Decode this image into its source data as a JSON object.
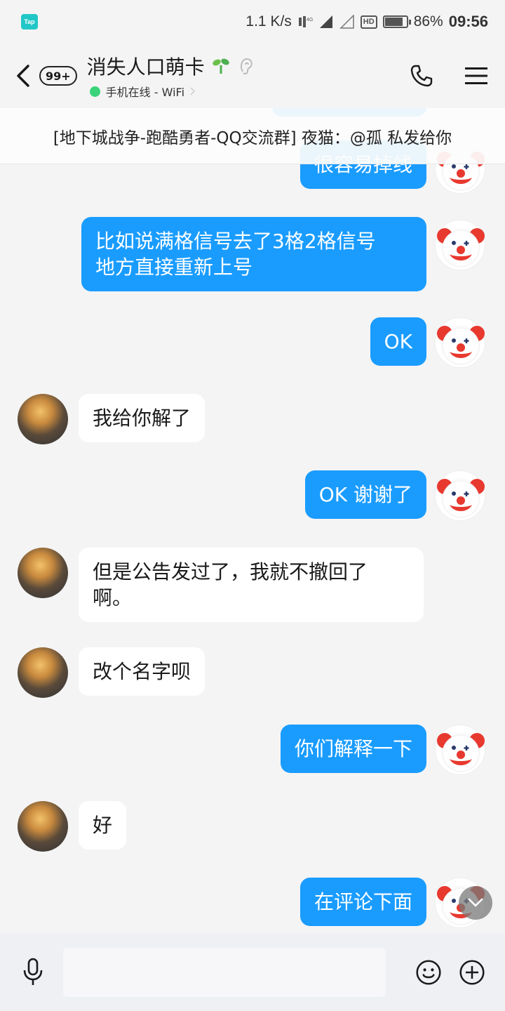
{
  "status_bar": {
    "app_badge": "Tap",
    "network_speed": "1.1 K/s",
    "net_type": "4G",
    "hd_label": "HD",
    "battery": "86%",
    "battery_level": 0.86,
    "time": "09:56"
  },
  "header": {
    "unread_count": "99+",
    "title": "消失人口萌卡",
    "online_status": "手机在线 - WiFi"
  },
  "banner": {
    "text": "[地下城战争-跑酷勇者-QQ交流群] 夜猫：@孤 私发给你"
  },
  "messages": [
    {
      "side": "mine",
      "lines": [
        "很容易掉线"
      ]
    },
    {
      "side": "mine",
      "lines": [
        "比如说满格信号去了3格2格信号",
        "地方直接重新上号"
      ]
    },
    {
      "side": "mine",
      "lines": [
        "OK"
      ]
    },
    {
      "side": "theirs",
      "lines": [
        "我给你解了"
      ]
    },
    {
      "side": "mine",
      "lines": [
        "OK 谢谢了"
      ]
    },
    {
      "side": "theirs",
      "lines": [
        "但是公告发过了，我就不撤回了",
        "啊。"
      ]
    },
    {
      "side": "theirs",
      "lines": [
        "改个名字呗"
      ]
    },
    {
      "side": "mine",
      "lines": [
        "你们解释一下"
      ]
    },
    {
      "side": "theirs",
      "lines": [
        "好"
      ]
    },
    {
      "side": "mine",
      "lines": [
        "在评论下面"
      ]
    }
  ],
  "input": {
    "value": "",
    "placeholder": ""
  },
  "colors": {
    "mine_bubble": "#1a9cff",
    "theirs_bubble": "#ffffff",
    "online_dot": "#3ad37a"
  }
}
